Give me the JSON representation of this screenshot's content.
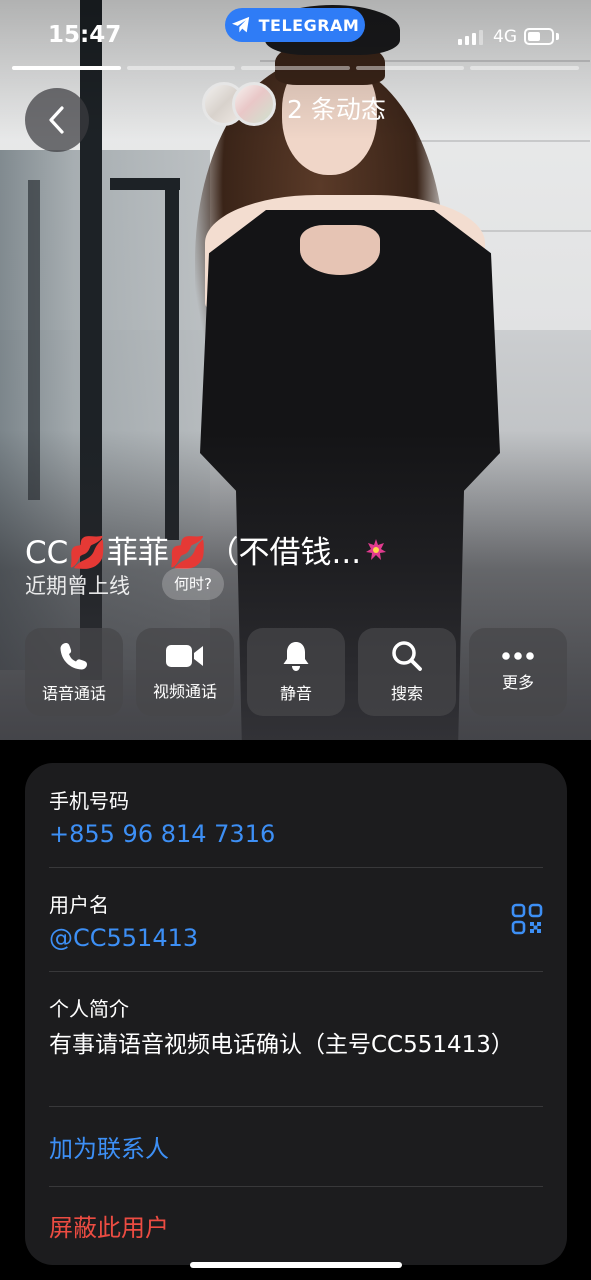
{
  "status_bar": {
    "time": "15:47",
    "app_pill": "TELEGRAM",
    "network": "4G"
  },
  "stories": {
    "count_label": "2 条动态"
  },
  "profile": {
    "name": "CC💋菲菲💋（不借钱...",
    "last_seen": "近期曾上线",
    "when_chip": "何时?"
  },
  "actions": [
    {
      "label": "语音通话",
      "icon": "phone-icon"
    },
    {
      "label": "视频通话",
      "icon": "video-camera-icon"
    },
    {
      "label": "静音",
      "icon": "bell-icon"
    },
    {
      "label": "搜索",
      "icon": "search-icon"
    },
    {
      "label": "更多",
      "icon": "more-icon"
    }
  ],
  "info": {
    "phone_label": "手机号码",
    "phone_value": "+855 96 814 7316",
    "username_label": "用户名",
    "username_value": "@CC551413",
    "bio_label": "个人简介",
    "bio_value": "有事请语音视频电话确认（主号CC551413）",
    "add_contact": "加为联系人",
    "block_user": "屏蔽此用户"
  },
  "colors": {
    "accent_blue": "#3d8ff5",
    "danger_red": "#ec4c42",
    "telegram_blue": "#2f7cf6",
    "card_bg": "#1c1c1e"
  }
}
